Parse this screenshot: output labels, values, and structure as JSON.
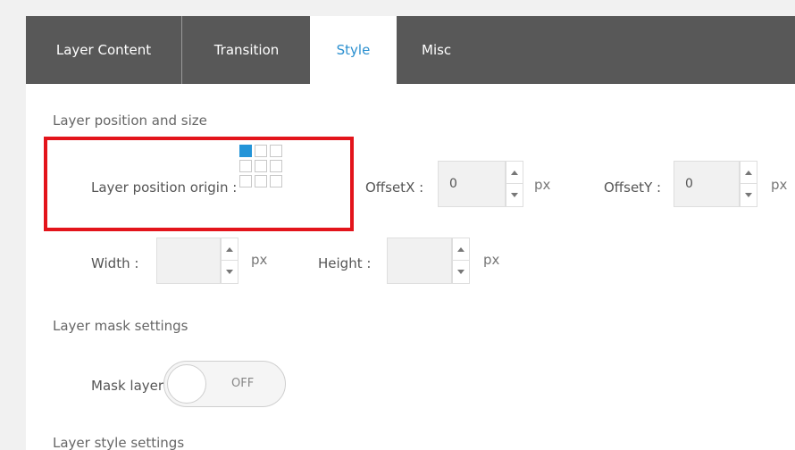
{
  "tabs": [
    {
      "label": "Layer Content"
    },
    {
      "label": "Transition"
    },
    {
      "label": "Style"
    },
    {
      "label": "Misc"
    }
  ],
  "sections": {
    "position": "Layer position and size",
    "mask": "Layer mask settings",
    "style": "Layer style settings"
  },
  "position_origin": {
    "label": "Layer position origin :",
    "selected": "top-left"
  },
  "offsetx": {
    "label": "OffsetX :",
    "value": "0",
    "unit": "px"
  },
  "offsety": {
    "label": "OffsetY :",
    "value": "0",
    "unit": "px"
  },
  "width": {
    "label": "Width :",
    "value": "",
    "unit": "px"
  },
  "height": {
    "label": "Height :",
    "value": "",
    "unit": "px"
  },
  "mask_layer": {
    "label": "Mask layer :",
    "state": "OFF"
  },
  "colors": {
    "tab_bg": "#585858",
    "active_tab_text": "#2a8fcf",
    "highlight": "#e3141b",
    "selected_cell": "#2494d8"
  }
}
